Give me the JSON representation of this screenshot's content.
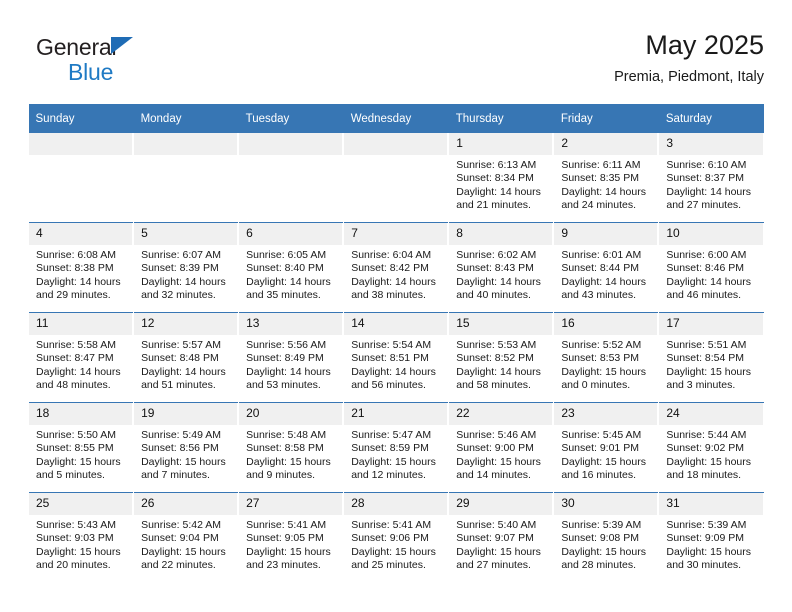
{
  "brand": {
    "name_top": "General",
    "name_bottom": "Blue",
    "accent_color": "#1f7ac4"
  },
  "header": {
    "title": "May 2025",
    "subtitle": "Premia, Piedmont, Italy",
    "header_bg_color": "#3776b4"
  },
  "calendar": {
    "weekday_headers": [
      "Sunday",
      "Monday",
      "Tuesday",
      "Wednesday",
      "Thursday",
      "Friday",
      "Saturday"
    ],
    "weeks": [
      [
        {
          "day": "",
          "lines": []
        },
        {
          "day": "",
          "lines": []
        },
        {
          "day": "",
          "lines": []
        },
        {
          "day": "",
          "lines": []
        },
        {
          "day": "1",
          "lines": [
            "Sunrise: 6:13 AM",
            "Sunset: 8:34 PM",
            "Daylight: 14 hours",
            "and 21 minutes."
          ]
        },
        {
          "day": "2",
          "lines": [
            "Sunrise: 6:11 AM",
            "Sunset: 8:35 PM",
            "Daylight: 14 hours",
            "and 24 minutes."
          ]
        },
        {
          "day": "3",
          "lines": [
            "Sunrise: 6:10 AM",
            "Sunset: 8:37 PM",
            "Daylight: 14 hours",
            "and 27 minutes."
          ]
        }
      ],
      [
        {
          "day": "4",
          "lines": [
            "Sunrise: 6:08 AM",
            "Sunset: 8:38 PM",
            "Daylight: 14 hours",
            "and 29 minutes."
          ]
        },
        {
          "day": "5",
          "lines": [
            "Sunrise: 6:07 AM",
            "Sunset: 8:39 PM",
            "Daylight: 14 hours",
            "and 32 minutes."
          ]
        },
        {
          "day": "6",
          "lines": [
            "Sunrise: 6:05 AM",
            "Sunset: 8:40 PM",
            "Daylight: 14 hours",
            "and 35 minutes."
          ]
        },
        {
          "day": "7",
          "lines": [
            "Sunrise: 6:04 AM",
            "Sunset: 8:42 PM",
            "Daylight: 14 hours",
            "and 38 minutes."
          ]
        },
        {
          "day": "8",
          "lines": [
            "Sunrise: 6:02 AM",
            "Sunset: 8:43 PM",
            "Daylight: 14 hours",
            "and 40 minutes."
          ]
        },
        {
          "day": "9",
          "lines": [
            "Sunrise: 6:01 AM",
            "Sunset: 8:44 PM",
            "Daylight: 14 hours",
            "and 43 minutes."
          ]
        },
        {
          "day": "10",
          "lines": [
            "Sunrise: 6:00 AM",
            "Sunset: 8:46 PM",
            "Daylight: 14 hours",
            "and 46 minutes."
          ]
        }
      ],
      [
        {
          "day": "11",
          "lines": [
            "Sunrise: 5:58 AM",
            "Sunset: 8:47 PM",
            "Daylight: 14 hours",
            "and 48 minutes."
          ]
        },
        {
          "day": "12",
          "lines": [
            "Sunrise: 5:57 AM",
            "Sunset: 8:48 PM",
            "Daylight: 14 hours",
            "and 51 minutes."
          ]
        },
        {
          "day": "13",
          "lines": [
            "Sunrise: 5:56 AM",
            "Sunset: 8:49 PM",
            "Daylight: 14 hours",
            "and 53 minutes."
          ]
        },
        {
          "day": "14",
          "lines": [
            "Sunrise: 5:54 AM",
            "Sunset: 8:51 PM",
            "Daylight: 14 hours",
            "and 56 minutes."
          ]
        },
        {
          "day": "15",
          "lines": [
            "Sunrise: 5:53 AM",
            "Sunset: 8:52 PM",
            "Daylight: 14 hours",
            "and 58 minutes."
          ]
        },
        {
          "day": "16",
          "lines": [
            "Sunrise: 5:52 AM",
            "Sunset: 8:53 PM",
            "Daylight: 15 hours",
            "and 0 minutes."
          ]
        },
        {
          "day": "17",
          "lines": [
            "Sunrise: 5:51 AM",
            "Sunset: 8:54 PM",
            "Daylight: 15 hours",
            "and 3 minutes."
          ]
        }
      ],
      [
        {
          "day": "18",
          "lines": [
            "Sunrise: 5:50 AM",
            "Sunset: 8:55 PM",
            "Daylight: 15 hours",
            "and 5 minutes."
          ]
        },
        {
          "day": "19",
          "lines": [
            "Sunrise: 5:49 AM",
            "Sunset: 8:56 PM",
            "Daylight: 15 hours",
            "and 7 minutes."
          ]
        },
        {
          "day": "20",
          "lines": [
            "Sunrise: 5:48 AM",
            "Sunset: 8:58 PM",
            "Daylight: 15 hours",
            "and 9 minutes."
          ]
        },
        {
          "day": "21",
          "lines": [
            "Sunrise: 5:47 AM",
            "Sunset: 8:59 PM",
            "Daylight: 15 hours",
            "and 12 minutes."
          ]
        },
        {
          "day": "22",
          "lines": [
            "Sunrise: 5:46 AM",
            "Sunset: 9:00 PM",
            "Daylight: 15 hours",
            "and 14 minutes."
          ]
        },
        {
          "day": "23",
          "lines": [
            "Sunrise: 5:45 AM",
            "Sunset: 9:01 PM",
            "Daylight: 15 hours",
            "and 16 minutes."
          ]
        },
        {
          "day": "24",
          "lines": [
            "Sunrise: 5:44 AM",
            "Sunset: 9:02 PM",
            "Daylight: 15 hours",
            "and 18 minutes."
          ]
        }
      ],
      [
        {
          "day": "25",
          "lines": [
            "Sunrise: 5:43 AM",
            "Sunset: 9:03 PM",
            "Daylight: 15 hours",
            "and 20 minutes."
          ]
        },
        {
          "day": "26",
          "lines": [
            "Sunrise: 5:42 AM",
            "Sunset: 9:04 PM",
            "Daylight: 15 hours",
            "and 22 minutes."
          ]
        },
        {
          "day": "27",
          "lines": [
            "Sunrise: 5:41 AM",
            "Sunset: 9:05 PM",
            "Daylight: 15 hours",
            "and 23 minutes."
          ]
        },
        {
          "day": "28",
          "lines": [
            "Sunrise: 5:41 AM",
            "Sunset: 9:06 PM",
            "Daylight: 15 hours",
            "and 25 minutes."
          ]
        },
        {
          "day": "29",
          "lines": [
            "Sunrise: 5:40 AM",
            "Sunset: 9:07 PM",
            "Daylight: 15 hours",
            "and 27 minutes."
          ]
        },
        {
          "day": "30",
          "lines": [
            "Sunrise: 5:39 AM",
            "Sunset: 9:08 PM",
            "Daylight: 15 hours",
            "and 28 minutes."
          ]
        },
        {
          "day": "31",
          "lines": [
            "Sunrise: 5:39 AM",
            "Sunset: 9:09 PM",
            "Daylight: 15 hours",
            "and 30 minutes."
          ]
        }
      ]
    ]
  }
}
